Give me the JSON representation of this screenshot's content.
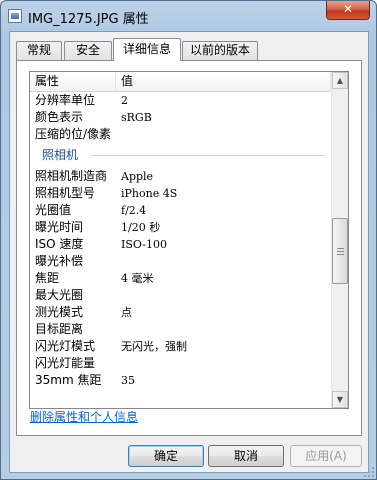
{
  "window": {
    "title": "IMG_1275.JPG 属性",
    "close_label": "✕"
  },
  "tabs": [
    {
      "label": "常规",
      "active": false
    },
    {
      "label": "安全",
      "active": false
    },
    {
      "label": "详细信息",
      "active": true
    },
    {
      "label": "以前的版本",
      "active": false
    }
  ],
  "listview": {
    "columns": {
      "property": "属性",
      "value": "值"
    },
    "rows_top": [
      {
        "property": "分辨率单位",
        "value": "2"
      },
      {
        "property": "颜色表示",
        "value": "sRGB"
      },
      {
        "property": "压缩的位/像素",
        "value": ""
      }
    ],
    "group_camera": "照相机",
    "rows_camera": [
      {
        "property": "照相机制造商",
        "value": "Apple"
      },
      {
        "property": "照相机型号",
        "value": "iPhone 4S"
      },
      {
        "property": "光圈值",
        "value": "f/2.4"
      },
      {
        "property": "曝光时间",
        "value": "1/20 秒"
      },
      {
        "property": "ISO 速度",
        "value": "ISO-100"
      },
      {
        "property": "曝光补偿",
        "value": ""
      },
      {
        "property": "焦距",
        "value": "4 毫米"
      },
      {
        "property": "最大光圈",
        "value": ""
      },
      {
        "property": "测光模式",
        "value": "点"
      },
      {
        "property": "目标距离",
        "value": ""
      },
      {
        "property": "闪光灯模式",
        "value": "无闪光，强制"
      },
      {
        "property": "闪光灯能量",
        "value": ""
      },
      {
        "property": "35mm 焦距",
        "value": "35"
      }
    ],
    "scrollbar": {
      "up_icon": "▲",
      "down_icon": "▼"
    }
  },
  "remove_link": "删除属性和个人信息",
  "buttons": {
    "ok": "确定",
    "cancel": "取消",
    "apply": "应用(A)"
  }
}
